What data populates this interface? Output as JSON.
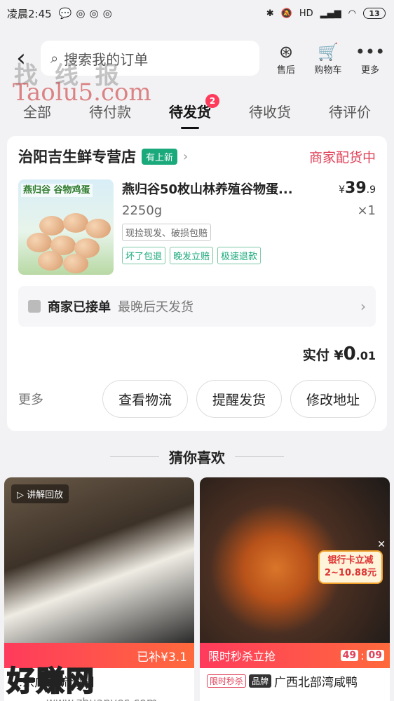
{
  "status_bar": {
    "time": "凌晨2:45",
    "battery": "13",
    "hd": "HD"
  },
  "watermark": {
    "line1": "找 线 报",
    "line2": "Taolu5.com",
    "bottom_big": "好赚网",
    "bottom_small": "www.zhuanyes.com"
  },
  "top_actions": [
    {
      "icon": "yen-refund-icon",
      "label": "售后"
    },
    {
      "icon": "cart-icon",
      "label": "购物车"
    },
    {
      "icon": "more-dots-icon",
      "label": "更多"
    }
  ],
  "search": {
    "placeholder": "搜索我的订单"
  },
  "tabs": [
    {
      "label": "全部"
    },
    {
      "label": "待付款"
    },
    {
      "label": "待发货",
      "badge": "2",
      "active": true
    },
    {
      "label": "待收货"
    },
    {
      "label": "待评价"
    }
  ],
  "order": {
    "store_name": "治阳吉生鲜专营店",
    "store_tag": "有上新",
    "status": "商家配货中",
    "product": {
      "thumb_label": "燕归谷 谷物鸡蛋",
      "name": "燕归谷50枚山林养殖谷物蛋...",
      "price_symbol": "¥",
      "price_int": "39",
      "price_dec": ".9",
      "spec": "2250g",
      "qty": "×1",
      "service_tag": "现捡现发、破损包赔",
      "guarantee_tags": [
        "坏了包退",
        "晚发立赔",
        "极速退款"
      ]
    },
    "notice": {
      "title": "商家已接单",
      "detail": "最晚后天发货"
    },
    "paid": {
      "label": "实付",
      "symbol": "¥",
      "int": "0",
      "dec": ".01"
    },
    "more_label": "更多",
    "buttons": [
      "查看物流",
      "提醒发货",
      "修改地址"
    ]
  },
  "recommend": {
    "heading": "猜你喜欢",
    "items": [
      {
        "replay_label": "讲解回放",
        "strip_text": "已补¥3.1",
        "title": "...宗广西流油翻"
      },
      {
        "bank_line1": "银行卡立减",
        "bank_line2": "2~10.88元",
        "strip_text": "限时秒杀立抢",
        "countdown": [
          "49",
          "09"
        ],
        "pill1": "限时秒杀",
        "pill2": "品牌",
        "title": "广西北部湾咸鸭"
      }
    ]
  },
  "colors": {
    "accent": "#e0435a",
    "green": "#1aa97b"
  }
}
